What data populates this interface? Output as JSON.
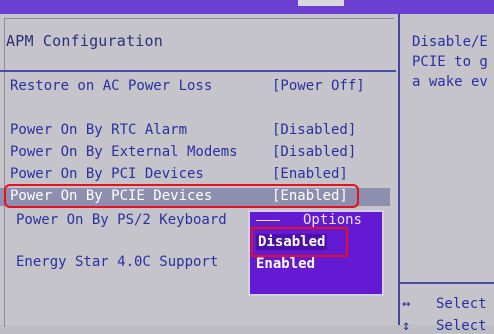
{
  "section_title": "APM Configuration",
  "settings": [
    {
      "label": "Restore on AC Power Loss",
      "value": "[Power Off]"
    },
    {
      "label": "Power On By RTC Alarm",
      "value": "[Disabled]"
    },
    {
      "label": "Power On By External Modems",
      "value": "[Disabled]"
    },
    {
      "label": "Power On By PCI Devices",
      "value": "[Enabled]"
    },
    {
      "label": "Power On By PCIE Devices",
      "value": "[Enabled]"
    },
    {
      "label": "Power On By PS/2 Keyboard",
      "value": ""
    },
    {
      "label": "Energy Star 4.0C Support",
      "value": ""
    }
  ],
  "options_popup": {
    "title": "Options",
    "options": [
      "Disabled",
      "Enabled"
    ],
    "selected": "Disabled"
  },
  "help": {
    "lines": [
      "Disable/E",
      "PCIE to g",
      "a wake ev"
    ]
  },
  "key_hints": [
    {
      "key": "↔",
      "label": "Select"
    },
    {
      "key": "↕",
      "label": "Select"
    }
  ],
  "colors": {
    "accent": "#6419d3",
    "highlight_box": "#e8101e",
    "text": "#2b30a0"
  }
}
